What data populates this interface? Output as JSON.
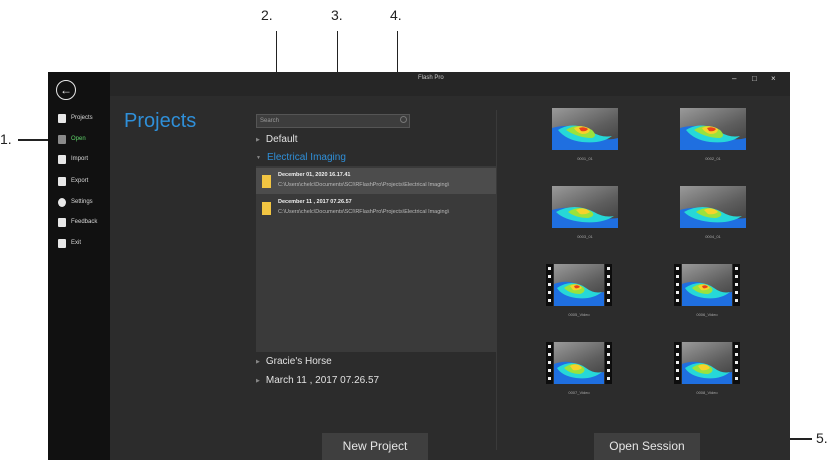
{
  "callouts": [
    "1.",
    "2.",
    "3.",
    "4.",
    "5."
  ],
  "window": {
    "title": "Flash Pro",
    "minimize": "–",
    "maximize": "□",
    "close": "×"
  },
  "sidebar": {
    "back_icon": "back-arrow-icon",
    "items": [
      {
        "label": "Projects",
        "icon": "file-icon"
      },
      {
        "label": "Open",
        "icon": "open-file-icon",
        "active": true
      },
      {
        "label": "Import",
        "icon": "import-icon"
      },
      {
        "label": "Export",
        "icon": "export-icon"
      },
      {
        "label": "Settings",
        "icon": "gear-icon"
      },
      {
        "label": "Feedback",
        "icon": "feedback-icon"
      },
      {
        "label": "Exit",
        "icon": "exit-icon"
      }
    ],
    "active_color": "#5fd36a"
  },
  "main": {
    "title": "Projects",
    "search_placeholder": "Search",
    "tree": [
      {
        "label": "Default",
        "expanded": false
      },
      {
        "label": "Electrical Imaging",
        "expanded": true
      },
      {
        "label": "Gracie's Horse",
        "expanded": false
      },
      {
        "label": "March 11 , 2017 07.26.57",
        "expanded": false
      }
    ],
    "sessions": [
      {
        "title": "December 01, 2020 16.17.41",
        "path": "C:\\Users\\chelc\\Documents\\SCI\\RFlashPro\\Projects\\Electrical Imaging\\"
      },
      {
        "title": "December 11 , 2017 07.26.57",
        "path": "C:\\Users\\chelc\\Documents\\SCI\\RFlashPro\\Projects\\Electrical Imaging\\"
      }
    ],
    "new_project_label": "New Project"
  },
  "thumbnails": [
    {
      "caption": "0001_01"
    },
    {
      "caption": "0002_01"
    },
    {
      "caption": "0003_01"
    },
    {
      "caption": "0004_01"
    },
    {
      "caption": "0005_Video"
    },
    {
      "caption": "0006_Video"
    },
    {
      "caption": "0007_Video"
    },
    {
      "caption": "0008_Video"
    }
  ],
  "open_session_label": "Open Session",
  "colors": {
    "accent": "#2f8fd8",
    "folder": "#f2c542",
    "background": "#2c2c2c",
    "sidebar": "#111111"
  }
}
